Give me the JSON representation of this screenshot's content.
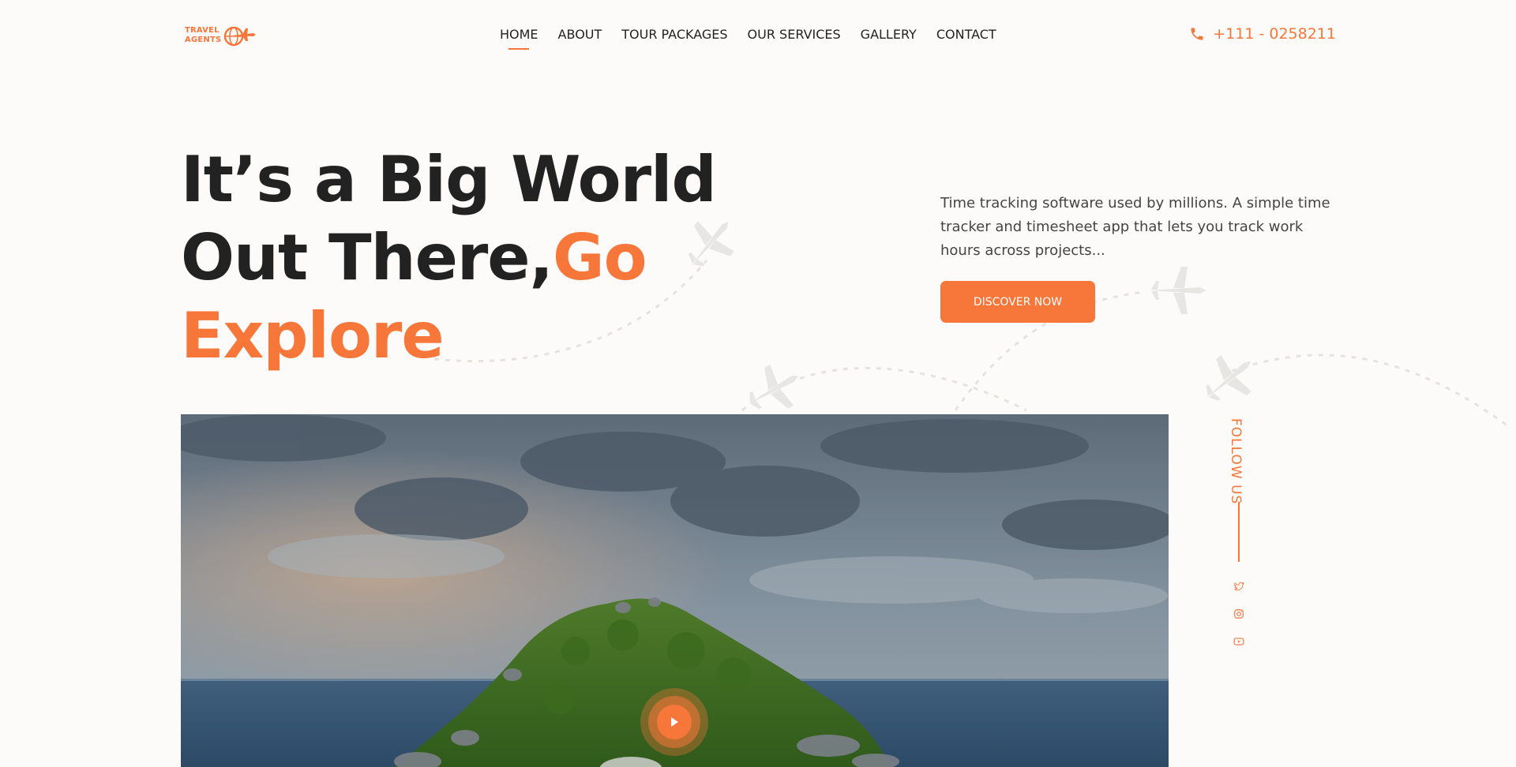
{
  "brand": {
    "logo_line1": "TRAVEL",
    "logo_line2": "AGENTS",
    "accent_color": "#f7763a"
  },
  "nav": {
    "items": [
      {
        "label": "HOME",
        "active": true
      },
      {
        "label": "ABOUT"
      },
      {
        "label": "TOUR PACKAGES"
      },
      {
        "label": "OUR SERVICES"
      },
      {
        "label": "GALLERY"
      },
      {
        "label": "CONTACT"
      }
    ]
  },
  "header": {
    "phone": "+111 - 0258211",
    "phone_icon": "phone-icon"
  },
  "hero": {
    "title_line1": "It’s a Big World",
    "title_line2": "Out There,",
    "title_accent_1": "Go",
    "title_accent_2": "Explore",
    "description": "Time tracking software used by millions. A simple time tracker and timesheet app that lets you track work hours across projects...",
    "cta_label": "DISCOVER NOW",
    "play_icon": "play-icon"
  },
  "sidebar": {
    "follow_label": "FOLLOW US",
    "socials": [
      "twitter-icon",
      "instagram-icon",
      "youtube-icon"
    ]
  }
}
